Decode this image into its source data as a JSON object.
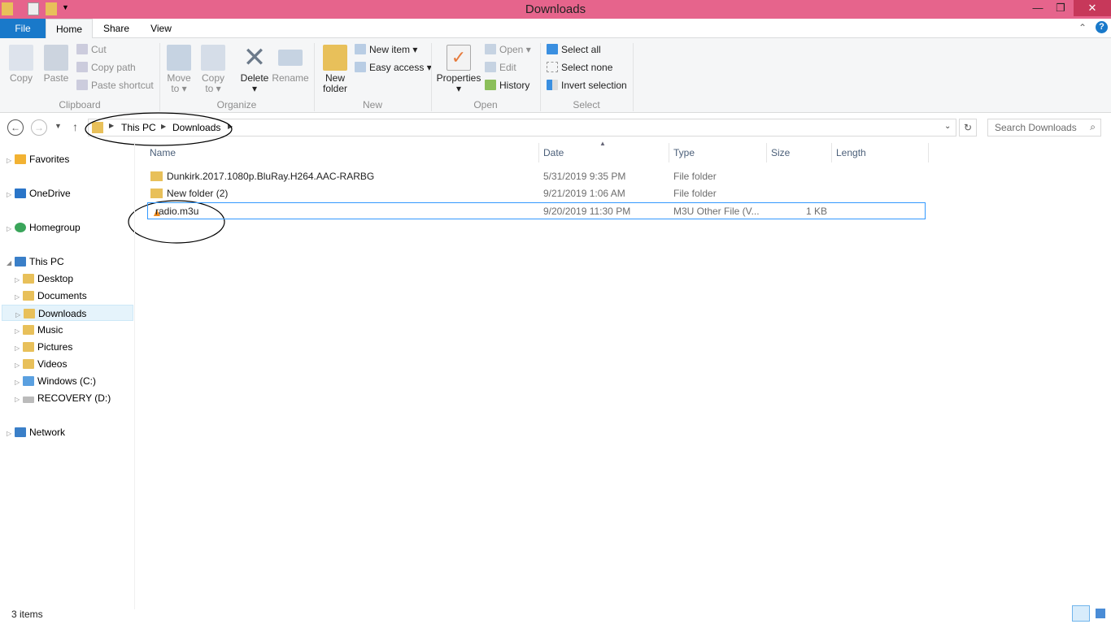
{
  "window": {
    "title": "Downloads"
  },
  "ribbon_tabs": [
    "File",
    "Home",
    "Share",
    "View"
  ],
  "ribbon": {
    "clipboard": {
      "label": "Clipboard",
      "copy": "Copy",
      "paste": "Paste",
      "cut": "Cut",
      "copy_path": "Copy path",
      "paste_shortcut": "Paste shortcut"
    },
    "organize": {
      "label": "Organize",
      "move_to": [
        "Move",
        "to"
      ],
      "copy_to": [
        "Copy",
        "to"
      ],
      "delete": "Delete",
      "rename": "Rename"
    },
    "new": {
      "label": "New",
      "new_folder": [
        "New",
        "folder"
      ],
      "new_item": "New item",
      "easy_access": "Easy access"
    },
    "open": {
      "label": "Open",
      "properties": "Properties",
      "open": "Open",
      "edit": "Edit",
      "history": "History"
    },
    "select": {
      "label": "Select",
      "select_all": "Select all",
      "select_none": "Select none",
      "invert": "Invert selection"
    }
  },
  "address": {
    "crumbs": [
      "This PC",
      "Downloads"
    ],
    "search_placeholder": "Search Downloads"
  },
  "nav": {
    "favorites": "Favorites",
    "onedrive": "OneDrive",
    "homegroup": "Homegroup",
    "this_pc": "This PC",
    "children": [
      "Desktop",
      "Documents",
      "Downloads",
      "Music",
      "Pictures",
      "Videos",
      "Windows (C:)",
      "RECOVERY (D:)"
    ],
    "network": "Network",
    "selected": "Downloads"
  },
  "columns": [
    "Name",
    "Date",
    "Type",
    "Size",
    "Length"
  ],
  "files": [
    {
      "name": "Dunkirk.2017.1080p.BluRay.H264.AAC-RARBG",
      "date": "5/31/2019 9:35 PM",
      "type": "File folder",
      "size": "",
      "icon": "folder-icon"
    },
    {
      "name": "New folder (2)",
      "date": "9/21/2019 1:06 AM",
      "type": "File folder",
      "size": "",
      "icon": "folder-icon"
    },
    {
      "name": "radio.m3u",
      "date": "9/20/2019 11:30 PM",
      "type": "M3U Other File (V...",
      "size": "1 KB",
      "icon": "vlc-cone-icon"
    }
  ],
  "status": {
    "items": "3 items"
  },
  "colors": {
    "titlebar": "#e6648c",
    "file_tab": "#1979ca",
    "selection": "#3399ff"
  }
}
